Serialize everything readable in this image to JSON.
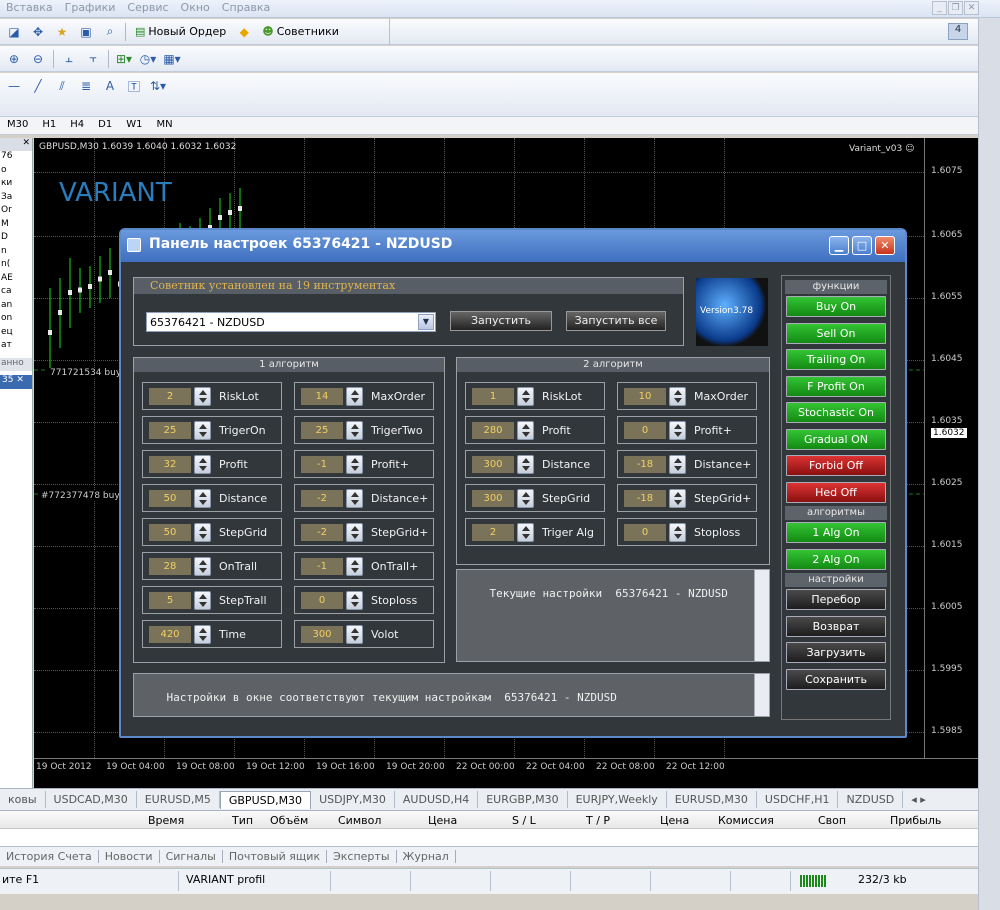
{
  "menu": [
    "Вставка",
    "Графики",
    "Сервис",
    "Окно",
    "Справка"
  ],
  "toolbar": {
    "new_order": "Новый Ордер",
    "advisors": "Советники",
    "badge": "4",
    "text_tool": "A"
  },
  "timeframes": [
    "M30",
    "H1",
    "H4",
    "D1",
    "W1",
    "MN"
  ],
  "left_panel": {
    "rows": [
      "76",
      "o",
      "ки",
      "За",
      "Or",
      "M",
      "D",
      "n",
      "n(",
      "AE",
      "ca",
      "an",
      "on",
      "ец",
      "ат"
    ],
    "footer": "анно",
    "count": "35"
  },
  "chart": {
    "symbol_info": "GBPUSD,M30  1.6039 1.6040 1.6032 1.6032",
    "ea_name": "Variant_v03",
    "watermark": "VARIANT",
    "order1": "771721534 buy",
    "order2": "#772377478 buy",
    "prices": [
      "1.6075",
      "1.6065",
      "1.6055",
      "1.6045",
      "1.6035",
      "1.6032",
      "1.6025",
      "1.6015",
      "1.6005",
      "1.5995",
      "1.5985"
    ],
    "times": [
      "19 Oct 2012",
      "19 Oct 04:00",
      "19 Oct 08:00",
      "19 Oct 12:00",
      "19 Oct 16:00",
      "19 Oct 20:00",
      "22 Oct 00:00",
      "22 Oct 04:00",
      "22 Oct 08:00",
      "22 Oct 12:00"
    ]
  },
  "panel": {
    "title": "Панель настроек 65376421 - NZDUSD",
    "installed": "Советник установлен на 19 инструментах",
    "selected_instrument": "65376421 - NZDUSD",
    "run": "Запустить",
    "run_all": "Запустить все",
    "version": "Version3.78",
    "algo1": {
      "header": "1 алгоритм",
      "params": [
        {
          "value": "2",
          "label": "RiskLot"
        },
        {
          "value": "14",
          "label": "MaxOrder"
        },
        {
          "value": "25",
          "label": "TrigerOn"
        },
        {
          "value": "25",
          "label": "TrigerTwo"
        },
        {
          "value": "32",
          "label": "Profit"
        },
        {
          "value": "-1",
          "label": "Profit+"
        },
        {
          "value": "50",
          "label": "Distance"
        },
        {
          "value": "-2",
          "label": "Distance+"
        },
        {
          "value": "50",
          "label": "StepGrid"
        },
        {
          "value": "-2",
          "label": "StepGrid+"
        },
        {
          "value": "28",
          "label": "OnTrall"
        },
        {
          "value": "-1",
          "label": "OnTrall+"
        },
        {
          "value": "5",
          "label": "StepTrall"
        },
        {
          "value": "0",
          "label": "Stoploss"
        },
        {
          "value": "420",
          "label": "Time"
        },
        {
          "value": "300",
          "label": "Volot"
        }
      ]
    },
    "algo2": {
      "header": "2 алгоритм",
      "params": [
        {
          "value": "1",
          "label": "RiskLot"
        },
        {
          "value": "10",
          "label": "MaxOrder"
        },
        {
          "value": "280",
          "label": "Profit"
        },
        {
          "value": "0",
          "label": "Profit+"
        },
        {
          "value": "300",
          "label": "Distance"
        },
        {
          "value": "-18",
          "label": "Distance+"
        },
        {
          "value": "300",
          "label": "StepGrid"
        },
        {
          "value": "-18",
          "label": "StepGrid+"
        },
        {
          "value": "2",
          "label": "Triger Alg"
        },
        {
          "value": "0",
          "label": "Stoploss"
        }
      ]
    },
    "current_settings": "Текущие настройки  65376421 - NZDUSD",
    "status_msg": "Настройки в окне соответствуют текущим настройкам  65376421 - NZDUSD",
    "functions_header": "функции",
    "functions": [
      {
        "label": "Buy On",
        "style": "green"
      },
      {
        "label": "Sell On",
        "style": "green"
      },
      {
        "label": "Trailing On",
        "style": "green"
      },
      {
        "label": "F Profit On",
        "style": "green"
      },
      {
        "label": "Stochastic On",
        "style": "green"
      },
      {
        "label": "Gradual ON",
        "style": "green"
      },
      {
        "label": "Forbid Off",
        "style": "red"
      },
      {
        "label": "Hed Off",
        "style": "red"
      }
    ],
    "algos_header": "алгоритмы",
    "algos": [
      {
        "label": "1 Alg On"
      },
      {
        "label": "2 Alg On"
      }
    ],
    "settings_header": "настройки",
    "settings": [
      {
        "label": "Перебор"
      },
      {
        "label": "Возврат"
      },
      {
        "label": "Загрузить"
      },
      {
        "label": "Сохранить"
      }
    ]
  },
  "chart_tabs": {
    "partial": "ковы",
    "items": [
      "USDCAD,M30",
      "EURUSD,M5",
      "GBPUSD,M30",
      "USDJPY,M30",
      "AUDUSD,H4",
      "EURGBP,M30",
      "EURJPY,Weekly",
      "EURUSD,M30",
      "USDCHF,H1",
      "NZDUSD"
    ],
    "active": "GBPUSD,M30"
  },
  "terminal": {
    "cols": [
      "Время",
      "Тип",
      "Объём",
      "Символ",
      "Цена",
      "S / L",
      "T / P",
      "Цена",
      "Комиссия",
      "Своп",
      "Прибыль"
    ]
  },
  "terminal_tabs": [
    "История Счета",
    "Новости",
    "Сигналы",
    "Почтовый ящик",
    "Эксперты",
    "Журнал"
  ],
  "status": {
    "help": "ите F1",
    "profile": "VARIANT profil",
    "traffic": "232/3 kb"
  }
}
